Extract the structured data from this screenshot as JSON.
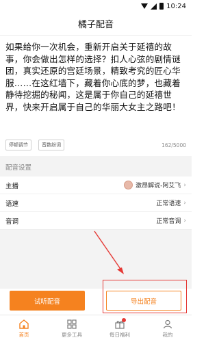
{
  "status": {
    "time": "10:24"
  },
  "app": {
    "title": "橘子配音"
  },
  "editor": {
    "text": "如果给你一次机会，重新开启关于延禧的故事，你会做出怎样的选择？扣人心弦的剧情谜团，真实还原的宫廷场景，精致考究的匠心华服……在这红墙下，藏着你心底的梦，也藏着静待挖掘的秘闻，这是属于你自己的延禧世界，快来开启属于自己的华丽大女主之路吧！",
    "tools": [
      "停顿调节",
      "音数纷词"
    ],
    "char_count": "162/5000"
  },
  "settings": {
    "section_label": "配音设置",
    "rows": [
      {
        "label": "主播",
        "value": "激昂解说-阿艾飞"
      },
      {
        "label": "语速",
        "value": "正常语速"
      },
      {
        "label": "音调",
        "value": "正常音调"
      }
    ]
  },
  "actions": {
    "trial": "试听配音",
    "export": "导出配音"
  },
  "nav": {
    "items": [
      {
        "label": "首页",
        "icon": "home-icon",
        "active": true
      },
      {
        "label": "更多工具",
        "icon": "grid-icon",
        "active": false
      },
      {
        "label": "每日福利",
        "icon": "gift-icon",
        "active": false
      },
      {
        "label": "我的",
        "icon": "user-icon",
        "active": false
      }
    ]
  },
  "colors": {
    "accent": "#f5821f",
    "annotation": "#e53935"
  }
}
